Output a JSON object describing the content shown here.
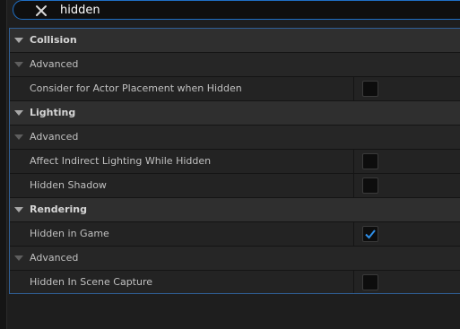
{
  "search": {
    "value": "hidden"
  },
  "panel": {
    "rows": [
      {
        "kind": "category",
        "label": "Collision"
      },
      {
        "kind": "subcat",
        "label": "Advanced"
      },
      {
        "kind": "prop",
        "label": "Consider for Actor Placement when Hidden",
        "checked": false
      },
      {
        "kind": "category",
        "label": "Lighting"
      },
      {
        "kind": "subcat",
        "label": "Advanced"
      },
      {
        "kind": "prop",
        "label": "Affect Indirect Lighting While Hidden",
        "checked": false
      },
      {
        "kind": "prop",
        "label": "Hidden Shadow",
        "checked": false
      },
      {
        "kind": "category",
        "label": "Rendering"
      },
      {
        "kind": "prop",
        "label": "Hidden in Game",
        "checked": true
      },
      {
        "kind": "subcat",
        "label": "Advanced"
      },
      {
        "kind": "prop",
        "label": "Hidden In Scene Capture",
        "checked": false
      }
    ]
  },
  "colors": {
    "accent": "#1f6fc5",
    "check": "#2f8fe8"
  }
}
